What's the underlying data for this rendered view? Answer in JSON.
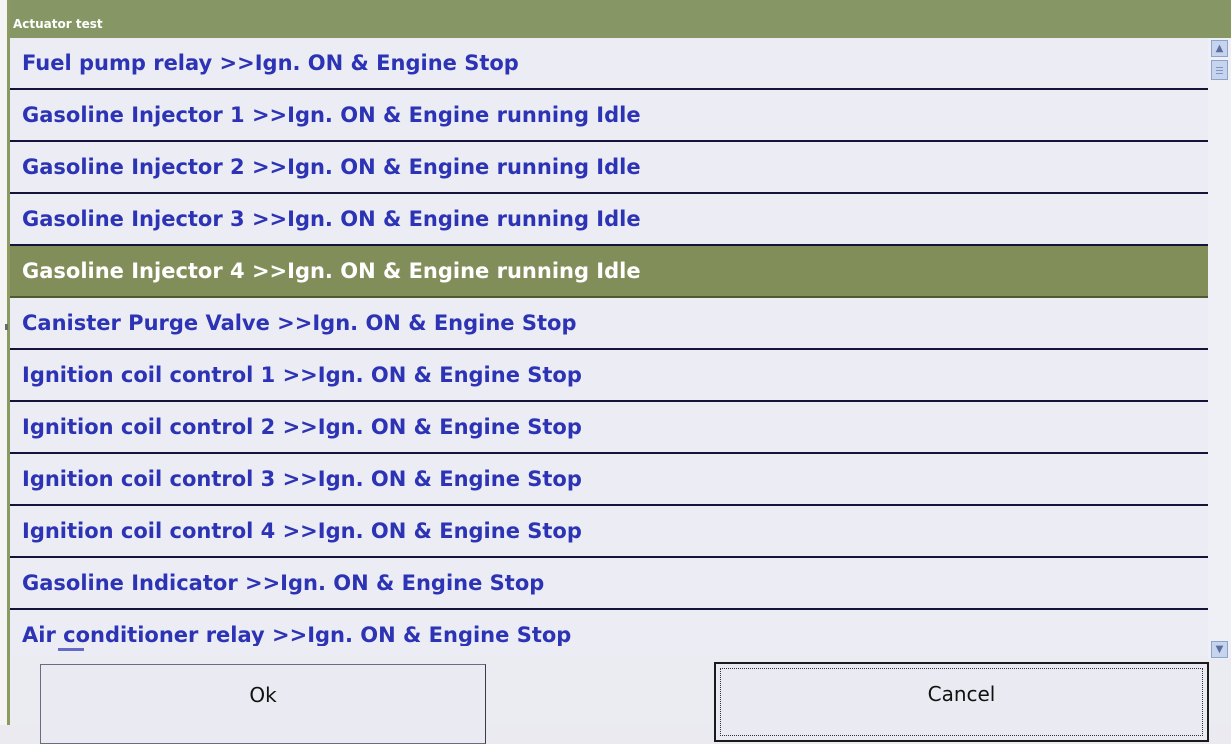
{
  "window": {
    "title": "Actuator test"
  },
  "items": [
    {
      "label": "Fuel pump relay >>Ign. ON & Engine Stop",
      "selected": false
    },
    {
      "label": "Gasoline Injector 1 >>Ign. ON & Engine running Idle",
      "selected": false
    },
    {
      "label": "Gasoline Injector 2 >>Ign. ON & Engine running Idle",
      "selected": false
    },
    {
      "label": "Gasoline Injector 3 >>Ign. ON & Engine running Idle",
      "selected": false
    },
    {
      "label": "Gasoline Injector 4 >>Ign. ON & Engine running Idle",
      "selected": true
    },
    {
      "label": "Canister Purge Valve >>Ign. ON & Engine Stop",
      "selected": false
    },
    {
      "label": "Ignition coil control 1 >>Ign. ON & Engine Stop",
      "selected": false
    },
    {
      "label": "Ignition coil control 2 >>Ign. ON & Engine Stop",
      "selected": false
    },
    {
      "label": "Ignition coil control 3 >>Ign. ON & Engine Stop",
      "selected": false
    },
    {
      "label": "Ignition coil control 4 >>Ign. ON & Engine Stop",
      "selected": false
    },
    {
      "label": "Gasoline Indicator >>Ign. ON & Engine Stop",
      "selected": false
    },
    {
      "label": "Air conditioner relay >>Ign. ON & Engine Stop",
      "selected": false
    }
  ],
  "buttons": {
    "ok": "Ok",
    "cancel": "Cancel"
  },
  "colors": {
    "titlebar": "#869664",
    "selected_row": "#828e5a",
    "item_text": "#2c33b4",
    "row_background": "#ecedf4"
  },
  "icons": {
    "scroll_up": "chevron-up-icon",
    "scroll_down": "chevron-down-icon"
  }
}
